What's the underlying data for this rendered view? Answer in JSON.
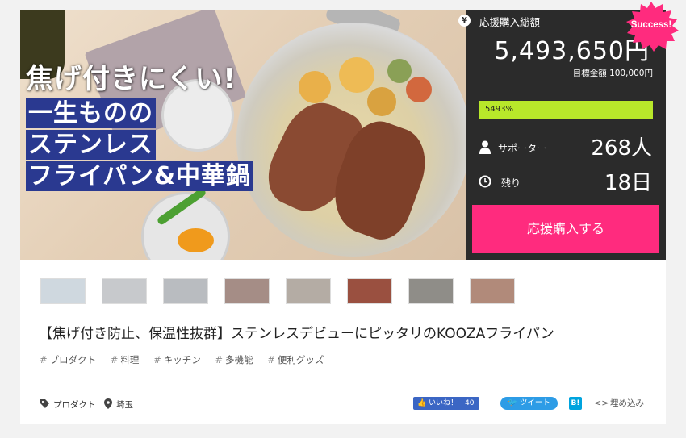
{
  "hero": {
    "headline": "焦げ付きにくい!",
    "lines": [
      "一生ものの",
      "ステンレス",
      "フライパン&中華鍋"
    ]
  },
  "badge": {
    "label": "Success!",
    "color": "#ff2b7e"
  },
  "funding": {
    "yen_icon": "¥",
    "total_label": "応援購入総額",
    "total_amount": "5,493,650円",
    "target_text": "目標金額 100,000円",
    "progress_text": "5493%",
    "progress_fraction": 1.0,
    "progress_color": "#b8e82a"
  },
  "stats": {
    "supporter_label": "サポーター",
    "supporter_count": "268人",
    "remaining_label": "残り",
    "remaining_count": "18日"
  },
  "cta": {
    "label": "応援購入する",
    "color": "#ff2b7e"
  },
  "thumbnails": [
    {
      "name": "thumbnail-1",
      "color": "#cfd8df"
    },
    {
      "name": "thumbnail-2",
      "color": "#c7c9cc"
    },
    {
      "name": "thumbnail-3",
      "color": "#b9bcc0"
    },
    {
      "name": "thumbnail-4",
      "color": "#a58d86"
    },
    {
      "name": "thumbnail-5",
      "color": "#b4aca4"
    },
    {
      "name": "thumbnail-6",
      "color": "#9a5040"
    },
    {
      "name": "thumbnail-7",
      "color": "#8f8d88"
    },
    {
      "name": "thumbnail-8",
      "color": "#b18a7a"
    }
  ],
  "title": "【焦げ付き防止、保温性抜群】ステンレスデビューにピッタリのKOOZAフライパン",
  "tags": [
    "プロダクト",
    "料理",
    "キッチン",
    "多機能",
    "便利グッズ"
  ],
  "meta": {
    "category": "プロダクト",
    "location": "埼玉"
  },
  "share": {
    "like_label": "いいね！",
    "like_count": "40",
    "tweet_label": "ツイート",
    "hatena_label": "B!",
    "embed_label": "埋め込み"
  }
}
